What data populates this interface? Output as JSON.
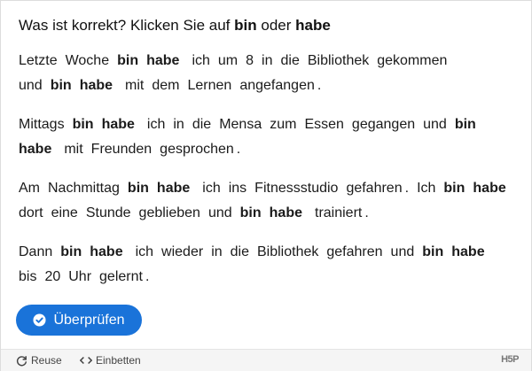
{
  "question": {
    "prefix": "Was ist korrekt? Klicken Sie auf",
    "option_a": "bin",
    "conjunction": "oder",
    "option_b": "habe"
  },
  "paragraphs": [
    {
      "line1": [
        "Letzte",
        "Woche"
      ],
      "line1_after": [
        "ich",
        "um",
        "8",
        "in",
        "die",
        "Bibliothek",
        "gekommen"
      ],
      "line2_pre": [
        "und"
      ],
      "line2_after": [
        "mit",
        "dem",
        "Lernen",
        "angefangen",
        "."
      ]
    },
    {
      "line1_pre": [
        "Mittags"
      ],
      "line1_after": [
        "ich",
        "in",
        "die",
        "Mensa",
        "zum",
        "Essen",
        "gegangen",
        "und"
      ],
      "line2_after": [
        "mit",
        "Freunden",
        "gesprochen",
        "."
      ]
    },
    {
      "line1_pre": [
        "Am",
        "Nachmittag"
      ],
      "line1_after": [
        "ich",
        "ins",
        "Fitnessstudio",
        "gefahren",
        ".",
        "Ich"
      ],
      "line2_pre": [
        "dort",
        "eine",
        "Stunde",
        "geblieben",
        "und"
      ],
      "line2_after": [
        "trainiert",
        "."
      ]
    },
    {
      "line1_pre": [
        "Dann"
      ],
      "line1_after": [
        "ich",
        "wieder",
        "in",
        "die",
        "Bibliothek",
        "gefahren",
        "und"
      ],
      "line2_pre": [
        "bis",
        "20",
        "Uhr",
        "gelernt",
        "."
      ]
    }
  ],
  "options": {
    "a": "bin",
    "b": "habe"
  },
  "check_button": {
    "label": "Überprüfen",
    "icon": "check-circle-icon"
  },
  "footer": {
    "reuse_label": "Reuse",
    "embed_label": "Einbetten",
    "logo_text": "H5P"
  },
  "colors": {
    "accent": "#1a73d9",
    "footer_bg": "#f5f5f5"
  }
}
